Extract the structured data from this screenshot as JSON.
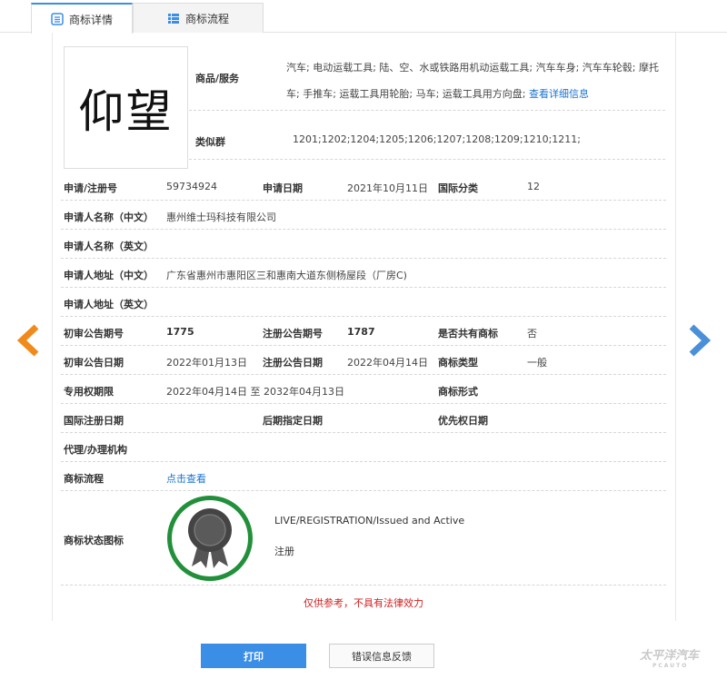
{
  "tabs": [
    {
      "label": "商标详情",
      "active": true
    },
    {
      "label": "商标流程",
      "active": false
    }
  ],
  "trademark_image_text": "仰望",
  "goods": {
    "label": "商品/服务",
    "text": "汽车; 电动运载工具; 陆、空、水或铁路用机动运载工具; 汽车车身; 汽车车轮毂; 摩托车; 手推车; 运载工具用轮胎; 马车; 运载工具用方向盘; ",
    "link": "查看详细信息"
  },
  "similar": {
    "label": "类似群",
    "value": "1201;1202;1204;1205;1206;1207;1208;1209;1210;1211;"
  },
  "fields": {
    "reg_no_label": "申请/注册号",
    "reg_no": "59734924",
    "apply_date_label": "申请日期",
    "apply_date": "2021年10月11日",
    "intl_class_label": "国际分类",
    "intl_class": "12",
    "applicant_cn_label": "申请人名称（中文）",
    "applicant_cn": "惠州维士玛科技有限公司",
    "applicant_en_label": "申请人名称（英文）",
    "applicant_en": "",
    "address_cn_label": "申请人地址（中文）",
    "address_cn": "广东省惠州市惠阳区三和惠南大道东侧杨屋段（厂房C)",
    "address_en_label": "申请人地址（英文）",
    "address_en": "",
    "prelim_pub_no_label": "初审公告期号",
    "prelim_pub_no": "1775",
    "reg_pub_no_label": "注册公告期号",
    "reg_pub_no": "1787",
    "shared_label": "是否共有商标",
    "shared": "否",
    "prelim_pub_date_label": "初审公告日期",
    "prelim_pub_date": "2022年01月13日",
    "reg_pub_date_label": "注册公告日期",
    "reg_pub_date": "2022年04月14日",
    "tm_type_label": "商标类型",
    "tm_type": "一般",
    "exclusive_label": "专用权期限",
    "exclusive": "2022年04月14日 至 2032年04月13日",
    "tm_form_label": "商标形式",
    "intl_reg_date_label": "国际注册日期",
    "later_designation_label": "后期指定日期",
    "priority_date_label": "优先权日期",
    "agent_label": "代理/办理机构",
    "process_label": "商标流程",
    "process_link": "点击查看",
    "status_label": "商标状态图标"
  },
  "status": {
    "en": "LIVE/REGISTRATION/Issued and Active",
    "cn": "注册"
  },
  "disclaimer": "仅供参考，不具有法律效力",
  "buttons": {
    "print": "打印",
    "report": "错误信息反馈"
  },
  "watermark": {
    "main": "太平洋汽车",
    "sub": "PCAUTO"
  },
  "colors": {
    "accent": "#3a8ee6",
    "nav_left": "#f08a1d",
    "nav_right": "#4a90d9",
    "status_ring": "#22903a",
    "disclaimer": "#d21f1f"
  }
}
